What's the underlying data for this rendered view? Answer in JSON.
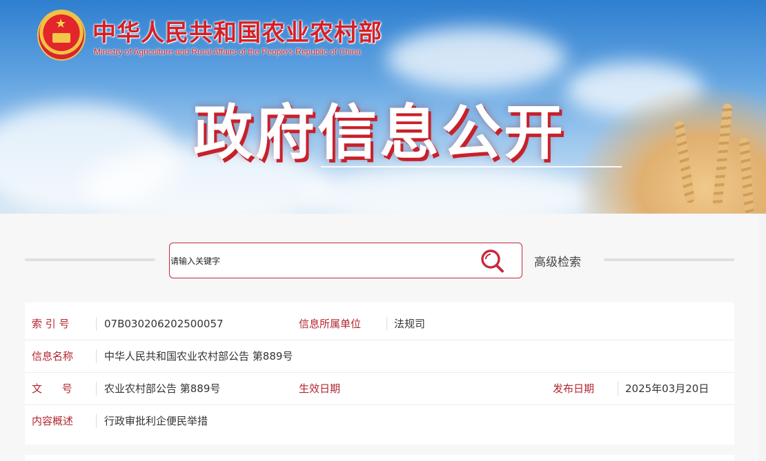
{
  "header": {
    "ministry_name_cn": "中华人民共和国农业农村部",
    "ministry_name_en": "Ministry of Agriculture and Rural Affairs of the People's Republic of China",
    "page_heading": "政府信息公开",
    "emblem_icon": "national-emblem-icon"
  },
  "search": {
    "placeholder": "请输入关键字",
    "value": "",
    "icon": "search-icon",
    "advanced_label": "高级检索"
  },
  "info": {
    "index_label": "索 引 号",
    "index_value": "07B030206202500057",
    "unit_label": "信息所属单位",
    "unit_value": "法规司",
    "name_label": "信息名称",
    "name_value": "中华人民共和国农业农村部公告 第889号",
    "doc_label": "文      号",
    "doc_value": "农业农村部公告 第889号",
    "effective_label": "生效日期",
    "effective_value": "",
    "publish_label": "发布日期",
    "publish_value": "2025年03月20日",
    "summary_label": "内容概述",
    "summary_value": "行政审批利企便民举措"
  },
  "colors": {
    "brand_red": "#d61f26",
    "label_red": "#b3252e",
    "search_border": "#c2283a"
  }
}
